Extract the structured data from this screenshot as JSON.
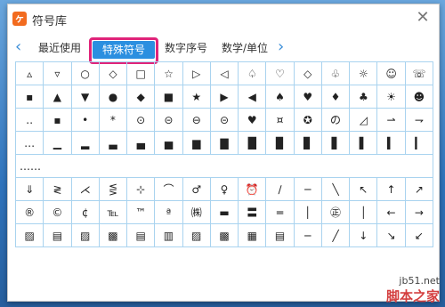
{
  "window": {
    "title": "符号库",
    "app_icon_glyph": "ヶ",
    "close_glyph": "✕"
  },
  "tabs": {
    "prev_glyph": "‹",
    "next_glyph": "›",
    "items": [
      {
        "label": "最近使用"
      },
      {
        "label": "特殊符号",
        "active": true
      },
      {
        "label": "数字序号"
      },
      {
        "label": "数学/单位"
      }
    ]
  },
  "symbols": {
    "rows": [
      [
        "▵",
        "▿",
        "○",
        "◇",
        "□",
        "☆",
        "▷",
        "◁",
        "♤",
        "♡",
        "◇",
        "♧",
        "☼",
        "☺",
        "☏"
      ],
      [
        "▪",
        "▲",
        "▼",
        "●",
        "◆",
        "■",
        "★",
        "▶",
        "◀",
        "♠",
        "♥",
        "♦",
        "♣",
        "☀",
        "☻"
      ],
      [
        "‥",
        "▪",
        "•",
        "*",
        "⊙",
        "⊝",
        "⊖",
        "⊝",
        "♥",
        "¤",
        "✪",
        "の",
        "◿",
        "⇀",
        "⇁"
      ],
      [
        "…",
        "▁",
        "▂",
        "▃",
        "▄",
        "▅",
        "▆",
        "▇",
        "█",
        "▉",
        "▊",
        "▋",
        "▌",
        "▍",
        "▎"
      ],
      [
        "……"
      ],
      [
        "⇓",
        "≷",
        "⋌",
        "⋚",
        "⊹",
        "⌒",
        "♂",
        "♀",
        "⏰",
        "∕",
        "─",
        "╲",
        "↖",
        "↑",
        "↗"
      ],
      [
        "®",
        "©",
        "¢",
        "℡",
        "™",
        "ª",
        "㈱",
        "▬",
        "〓",
        "═",
        "│",
        "㊣",
        "│",
        "←",
        "→"
      ],
      [
        "▨",
        "▤",
        "▨",
        "▩",
        "▤",
        "▥",
        "▨",
        "▩",
        "▦",
        "▤",
        "─",
        "╱",
        "↓",
        "↘",
        "↙"
      ]
    ]
  },
  "watermark": {
    "site": "jb51.net",
    "text": "脚本之家"
  },
  "colors": {
    "accent": "#2b8fe0",
    "highlight_border": "#e0247a",
    "grid_line": "#a9d3ef"
  }
}
